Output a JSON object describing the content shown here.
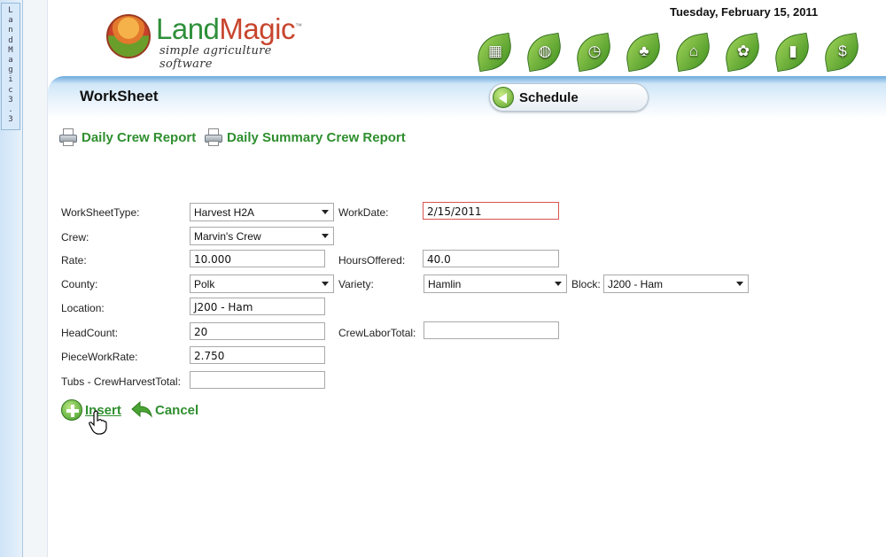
{
  "sidebar": {
    "tab_label": [
      "L",
      "a",
      "n",
      "d",
      "M",
      "a",
      "g",
      "i",
      "c",
      " ",
      "3",
      ".",
      "3"
    ]
  },
  "header": {
    "logo_land": "Land",
    "logo_magic": "Magic",
    "logo_tm": "™",
    "logo_tagline": "simple agriculture software",
    "date": "Tuesday, February 15, 2011",
    "nav_icons": [
      {
        "name": "blocks-nav-icon",
        "glyph": "▦"
      },
      {
        "name": "globe-nav-icon",
        "glyph": "◍"
      },
      {
        "name": "worker-clock-nav-icon",
        "glyph": "◷"
      },
      {
        "name": "plant-nav-icon",
        "glyph": "♣"
      },
      {
        "name": "barn-nav-icon",
        "glyph": "⌂"
      },
      {
        "name": "produce-nav-icon",
        "glyph": "✿"
      },
      {
        "name": "pda-nav-icon",
        "glyph": "▮"
      },
      {
        "name": "money-nav-icon",
        "glyph": "$"
      }
    ]
  },
  "page": {
    "title": "WorkSheet",
    "schedule_button": "Schedule",
    "reports": {
      "daily_crew": "Daily Crew Report",
      "daily_summary": "Daily Summary Crew Report"
    }
  },
  "form": {
    "worksheet_type": {
      "label": "WorkSheetType:",
      "value": "Harvest H2A"
    },
    "work_date": {
      "label": "WorkDate:",
      "value": "2/15/2011"
    },
    "crew": {
      "label": "Crew:",
      "value": "Marvin's Crew"
    },
    "rate": {
      "label": "Rate:",
      "value": "10.000"
    },
    "hours_offered": {
      "label": "HoursOffered:",
      "value": "40.0"
    },
    "county": {
      "label": "County:",
      "value": "Polk"
    },
    "variety": {
      "label": "Variety:",
      "value": "Hamlin"
    },
    "block": {
      "label": "Block:",
      "value": "J200 - Ham"
    },
    "location": {
      "label": "Location:",
      "value": "J200 - Ham"
    },
    "head_count": {
      "label": "HeadCount:",
      "value": "20"
    },
    "crew_labor_total": {
      "label": "CrewLaborTotal:",
      "value": ""
    },
    "piece_work_rate": {
      "label": "PieceWorkRate:",
      "value": "2.750"
    },
    "tubs_crew_harvest_total": {
      "label": "Tubs - CrewHarvestTotal:",
      "value": ""
    }
  },
  "actions": {
    "insert": "Insert",
    "cancel": "Cancel"
  }
}
